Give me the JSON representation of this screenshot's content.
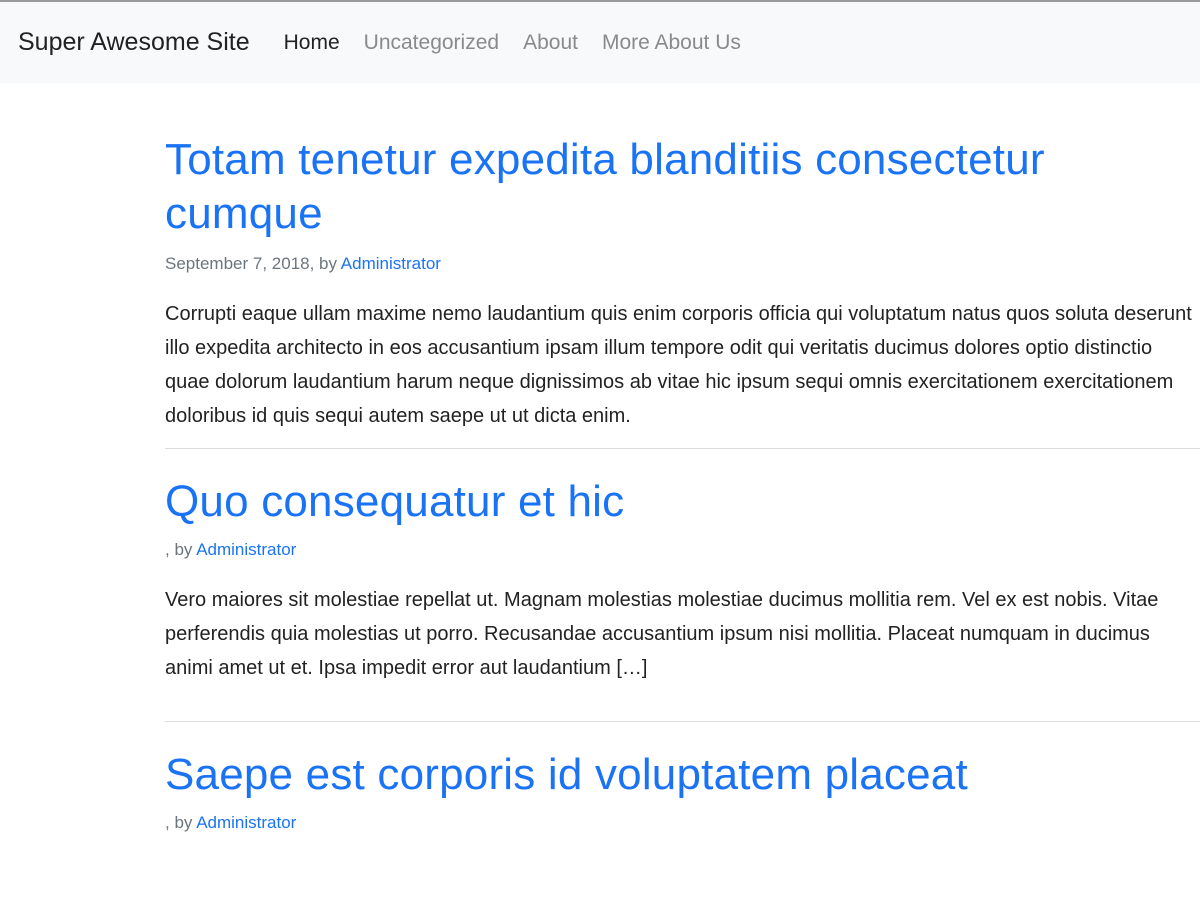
{
  "site": {
    "brand": "Super Awesome Site"
  },
  "nav": {
    "items": [
      {
        "label": "Home",
        "active": true
      },
      {
        "label": "Uncategorized",
        "active": false
      },
      {
        "label": "About",
        "active": false
      },
      {
        "label": "More About Us",
        "active": false
      }
    ]
  },
  "posts": [
    {
      "title": "Totam tenetur expedita blanditiis consectetur cumque",
      "date": "September 7, 2018",
      "by": ", by ",
      "author": "Administrator",
      "excerpt": "Corrupti eaque ullam maxime nemo laudantium quis enim corporis officia qui voluptatum natus quos soluta deserunt illo expedita architecto in eos accusantium ipsam illum tempore odit qui veritatis ducimus dolores optio distinctio quae dolorum laudantium harum neque dignissimos ab vitae hic ipsum sequi omnis exercitationem exercitationem doloribus id quis sequi autem saepe ut ut dicta enim."
    },
    {
      "title": "Quo consequatur et hic",
      "date": "",
      "by": ", by ",
      "author": "Administrator",
      "excerpt": "Vero maiores sit molestiae repellat ut. Magnam molestias molestiae ducimus mollitia rem. Vel ex est nobis. Vitae perferendis quia molestias ut porro. Recusandae accusantium ipsum nisi mollitia. Placeat numquam in ducimus animi amet ut et. Ipsa impedit error aut laudantium […]"
    },
    {
      "title": "Saepe est corporis id voluptatem placeat",
      "date": "",
      "by": ", by ",
      "author": "Administrator",
      "excerpt": ""
    }
  ],
  "colors": {
    "link": "#1a73f5",
    "navbar_bg": "#f8f9fa",
    "text": "#222222",
    "muted": "#6c757d"
  }
}
